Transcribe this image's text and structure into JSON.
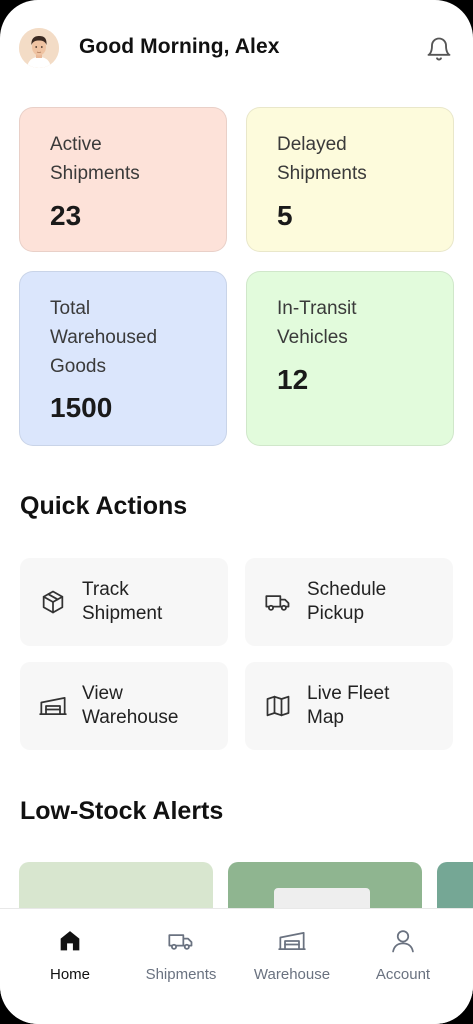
{
  "header": {
    "greeting": "Good Morning, Alex"
  },
  "stats": [
    {
      "label": "Active Shipments",
      "value": "23",
      "color": "#fde2d9"
    },
    {
      "label": "Delayed Shipments",
      "value": "5",
      "color": "#fdfbdc"
    },
    {
      "label": "Total Warehoused Goods",
      "value": "1500",
      "color": "#dbe6fc"
    },
    {
      "label": "In-Transit Vehicles",
      "value": "12",
      "color": "#e2fbdc"
    }
  ],
  "quick_actions": {
    "title": "Quick Actions",
    "items": [
      {
        "label": "Track Shipment",
        "icon": "package-icon"
      },
      {
        "label": "Schedule Pickup",
        "icon": "truck-icon"
      },
      {
        "label": "View Warehouse",
        "icon": "warehouse-icon"
      },
      {
        "label": "Live Fleet Map",
        "icon": "map-icon"
      }
    ]
  },
  "low_stock": {
    "title": "Low-Stock Alerts"
  },
  "nav": {
    "items": [
      {
        "label": "Home",
        "icon": "home-icon",
        "active": true
      },
      {
        "label": "Shipments",
        "icon": "truck-icon",
        "active": false
      },
      {
        "label": "Warehouse",
        "icon": "warehouse-icon",
        "active": false
      },
      {
        "label": "Account",
        "icon": "user-icon",
        "active": false
      }
    ]
  },
  "colors": {
    "text_primary": "#111111",
    "nav_inactive": "#6a7280"
  }
}
